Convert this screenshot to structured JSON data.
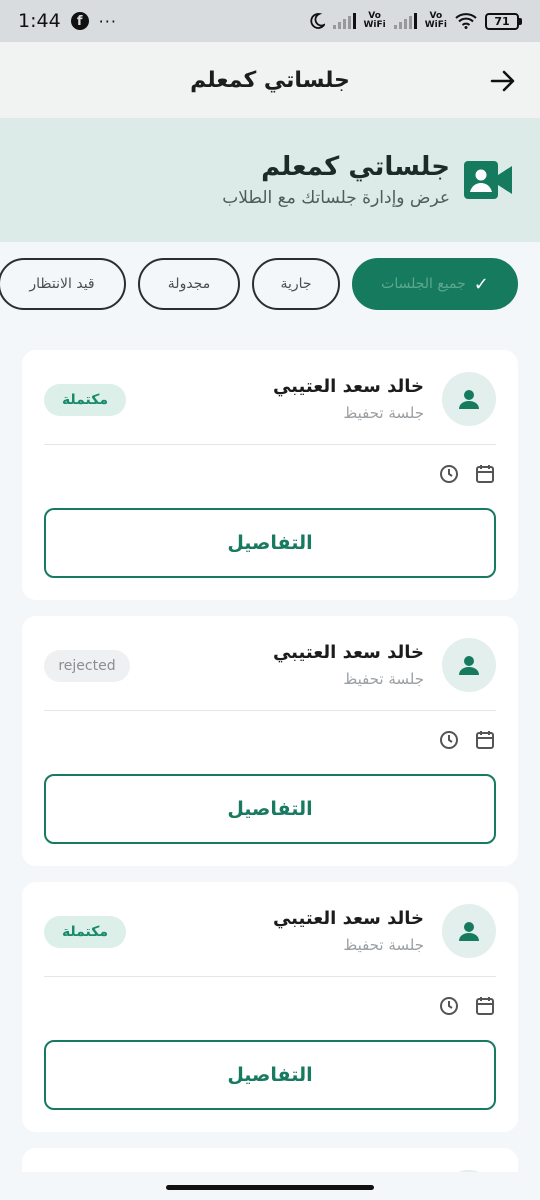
{
  "status_bar": {
    "time": "1:44",
    "dots": "···",
    "volte_1": "Vo\nWiFi",
    "volte_2": "Vo\nWiFi",
    "battery": "71"
  },
  "app_bar": {
    "title": "جلساتي كمعلم"
  },
  "hero": {
    "title": "جلساتي كمعلم",
    "subtitle": "عرض وإدارة جلساتك مع الطلاب",
    "accent": "#167a5f"
  },
  "filters": [
    {
      "label": "جميع الجلسات",
      "selected": true
    },
    {
      "label": "جارية",
      "selected": false
    },
    {
      "label": "مجدولة",
      "selected": false
    },
    {
      "label": "قيد الانتظار",
      "selected": false
    }
  ],
  "sessions": [
    {
      "name": "خالد سعد العتيبي",
      "type": "جلسة تحفيظ",
      "status": "مكتملة",
      "status_kind": "done",
      "details_label": "التفاصيل"
    },
    {
      "name": "خالد سعد العتيبي",
      "type": "جلسة تحفيظ",
      "status": "rejected",
      "status_kind": "rejected",
      "details_label": "التفاصيل"
    },
    {
      "name": "خالد سعد العتيبي",
      "type": "جلسة تحفيظ",
      "status": "مكتملة",
      "status_kind": "done",
      "details_label": "التفاصيل"
    }
  ]
}
